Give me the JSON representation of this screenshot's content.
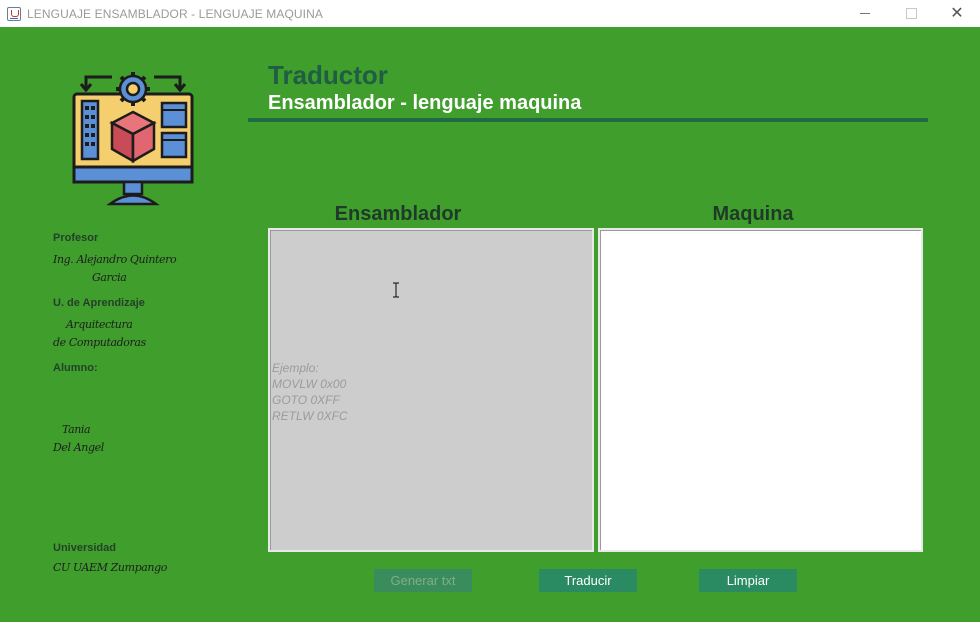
{
  "window": {
    "title": "LENGUAJE ENSAMBLADOR - LENGUAJE MAQUINA"
  },
  "logo": {
    "icon": "computer-settings-cube-icon"
  },
  "sidebar": {
    "profesor_label": "Profesor",
    "profesor_line1": "Ing. Alejandro Quintero",
    "profesor_line2": "Garcia",
    "ua_label": "U. de Aprendizaje",
    "ua_line1": "Arquitectura",
    "ua_line2": "de Computadoras",
    "alumno_label": "Alumno:",
    "alumno_line1": "Tania",
    "alumno_line2": "Del Angel",
    "universidad_label": "Universidad",
    "universidad_value": "CU UAEM Zumpango"
  },
  "header": {
    "title": "Traductor",
    "subtitle": "Ensamblador - lenguaje maquina"
  },
  "panels": {
    "ensamblador_title": "Ensamblador",
    "maquina_title": "Maquina",
    "ensamblador_placeholder": "Ejemplo:\nMOVLW 0x00\nGOTO 0XFF\nRETLW 0XFC",
    "maquina_value": ""
  },
  "buttons": {
    "generar": "Generar txt",
    "traducir": "Traducir",
    "limpiar": "Limpiar"
  },
  "colors": {
    "background": "#3f9e2c",
    "accent": "#1f6a45",
    "button": "#2a8a62"
  }
}
